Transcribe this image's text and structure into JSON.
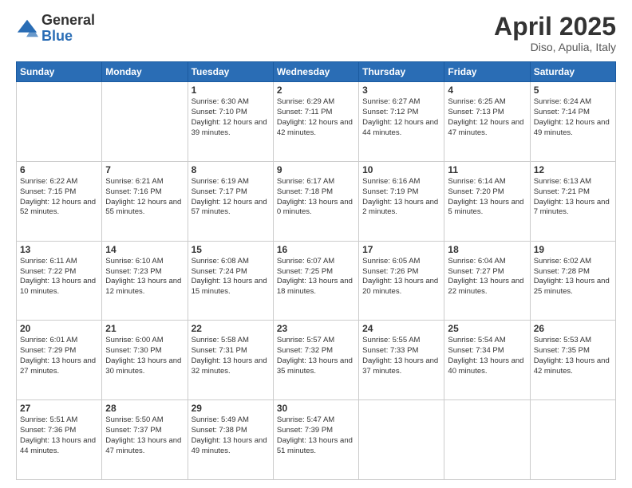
{
  "logo": {
    "general": "General",
    "blue": "Blue"
  },
  "header": {
    "month": "April 2025",
    "location": "Diso, Apulia, Italy"
  },
  "weekdays": [
    "Sunday",
    "Monday",
    "Tuesday",
    "Wednesday",
    "Thursday",
    "Friday",
    "Saturday"
  ],
  "weeks": [
    [
      {
        "day": "",
        "info": ""
      },
      {
        "day": "",
        "info": ""
      },
      {
        "day": "1",
        "info": "Sunrise: 6:30 AM\nSunset: 7:10 PM\nDaylight: 12 hours and 39 minutes."
      },
      {
        "day": "2",
        "info": "Sunrise: 6:29 AM\nSunset: 7:11 PM\nDaylight: 12 hours and 42 minutes."
      },
      {
        "day": "3",
        "info": "Sunrise: 6:27 AM\nSunset: 7:12 PM\nDaylight: 12 hours and 44 minutes."
      },
      {
        "day": "4",
        "info": "Sunrise: 6:25 AM\nSunset: 7:13 PM\nDaylight: 12 hours and 47 minutes."
      },
      {
        "day": "5",
        "info": "Sunrise: 6:24 AM\nSunset: 7:14 PM\nDaylight: 12 hours and 49 minutes."
      }
    ],
    [
      {
        "day": "6",
        "info": "Sunrise: 6:22 AM\nSunset: 7:15 PM\nDaylight: 12 hours and 52 minutes."
      },
      {
        "day": "7",
        "info": "Sunrise: 6:21 AM\nSunset: 7:16 PM\nDaylight: 12 hours and 55 minutes."
      },
      {
        "day": "8",
        "info": "Sunrise: 6:19 AM\nSunset: 7:17 PM\nDaylight: 12 hours and 57 minutes."
      },
      {
        "day": "9",
        "info": "Sunrise: 6:17 AM\nSunset: 7:18 PM\nDaylight: 13 hours and 0 minutes."
      },
      {
        "day": "10",
        "info": "Sunrise: 6:16 AM\nSunset: 7:19 PM\nDaylight: 13 hours and 2 minutes."
      },
      {
        "day": "11",
        "info": "Sunrise: 6:14 AM\nSunset: 7:20 PM\nDaylight: 13 hours and 5 minutes."
      },
      {
        "day": "12",
        "info": "Sunrise: 6:13 AM\nSunset: 7:21 PM\nDaylight: 13 hours and 7 minutes."
      }
    ],
    [
      {
        "day": "13",
        "info": "Sunrise: 6:11 AM\nSunset: 7:22 PM\nDaylight: 13 hours and 10 minutes."
      },
      {
        "day": "14",
        "info": "Sunrise: 6:10 AM\nSunset: 7:23 PM\nDaylight: 13 hours and 12 minutes."
      },
      {
        "day": "15",
        "info": "Sunrise: 6:08 AM\nSunset: 7:24 PM\nDaylight: 13 hours and 15 minutes."
      },
      {
        "day": "16",
        "info": "Sunrise: 6:07 AM\nSunset: 7:25 PM\nDaylight: 13 hours and 18 minutes."
      },
      {
        "day": "17",
        "info": "Sunrise: 6:05 AM\nSunset: 7:26 PM\nDaylight: 13 hours and 20 minutes."
      },
      {
        "day": "18",
        "info": "Sunrise: 6:04 AM\nSunset: 7:27 PM\nDaylight: 13 hours and 22 minutes."
      },
      {
        "day": "19",
        "info": "Sunrise: 6:02 AM\nSunset: 7:28 PM\nDaylight: 13 hours and 25 minutes."
      }
    ],
    [
      {
        "day": "20",
        "info": "Sunrise: 6:01 AM\nSunset: 7:29 PM\nDaylight: 13 hours and 27 minutes."
      },
      {
        "day": "21",
        "info": "Sunrise: 6:00 AM\nSunset: 7:30 PM\nDaylight: 13 hours and 30 minutes."
      },
      {
        "day": "22",
        "info": "Sunrise: 5:58 AM\nSunset: 7:31 PM\nDaylight: 13 hours and 32 minutes."
      },
      {
        "day": "23",
        "info": "Sunrise: 5:57 AM\nSunset: 7:32 PM\nDaylight: 13 hours and 35 minutes."
      },
      {
        "day": "24",
        "info": "Sunrise: 5:55 AM\nSunset: 7:33 PM\nDaylight: 13 hours and 37 minutes."
      },
      {
        "day": "25",
        "info": "Sunrise: 5:54 AM\nSunset: 7:34 PM\nDaylight: 13 hours and 40 minutes."
      },
      {
        "day": "26",
        "info": "Sunrise: 5:53 AM\nSunset: 7:35 PM\nDaylight: 13 hours and 42 minutes."
      }
    ],
    [
      {
        "day": "27",
        "info": "Sunrise: 5:51 AM\nSunset: 7:36 PM\nDaylight: 13 hours and 44 minutes."
      },
      {
        "day": "28",
        "info": "Sunrise: 5:50 AM\nSunset: 7:37 PM\nDaylight: 13 hours and 47 minutes."
      },
      {
        "day": "29",
        "info": "Sunrise: 5:49 AM\nSunset: 7:38 PM\nDaylight: 13 hours and 49 minutes."
      },
      {
        "day": "30",
        "info": "Sunrise: 5:47 AM\nSunset: 7:39 PM\nDaylight: 13 hours and 51 minutes."
      },
      {
        "day": "",
        "info": ""
      },
      {
        "day": "",
        "info": ""
      },
      {
        "day": "",
        "info": ""
      }
    ]
  ]
}
